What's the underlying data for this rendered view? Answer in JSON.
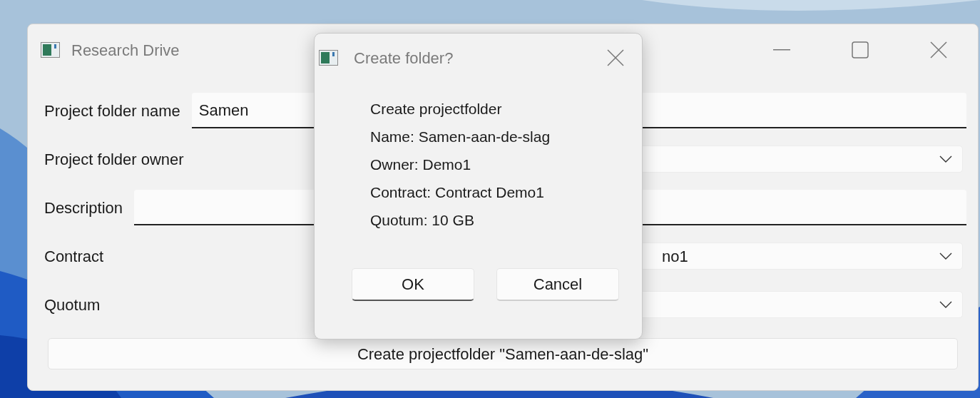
{
  "window": {
    "title": "Research Drive"
  },
  "form": {
    "rows": [
      {
        "kind": "text",
        "label": "Project folder name",
        "value": "Samen"
      },
      {
        "kind": "combo",
        "label": "Project folder owner"
      },
      {
        "kind": "text",
        "label": "Description"
      },
      {
        "kind": "combo",
        "label": "Contract",
        "value": "no1"
      },
      {
        "kind": "combo",
        "label": "Quotum"
      }
    ],
    "submit": "Create projectfolder \"Samen-aan-de-slag\""
  },
  "dialog": {
    "title": "Create folder?",
    "lines": [
      "Create projectfolder",
      "Name: Samen-aan-de-slag",
      "Owner: Demo1",
      "Contract: Contract Demo1",
      "Quotum: 10 GB"
    ],
    "buttons": [
      {
        "label": "OK",
        "default": true
      },
      {
        "label": "Cancel",
        "default": false
      }
    ]
  }
}
